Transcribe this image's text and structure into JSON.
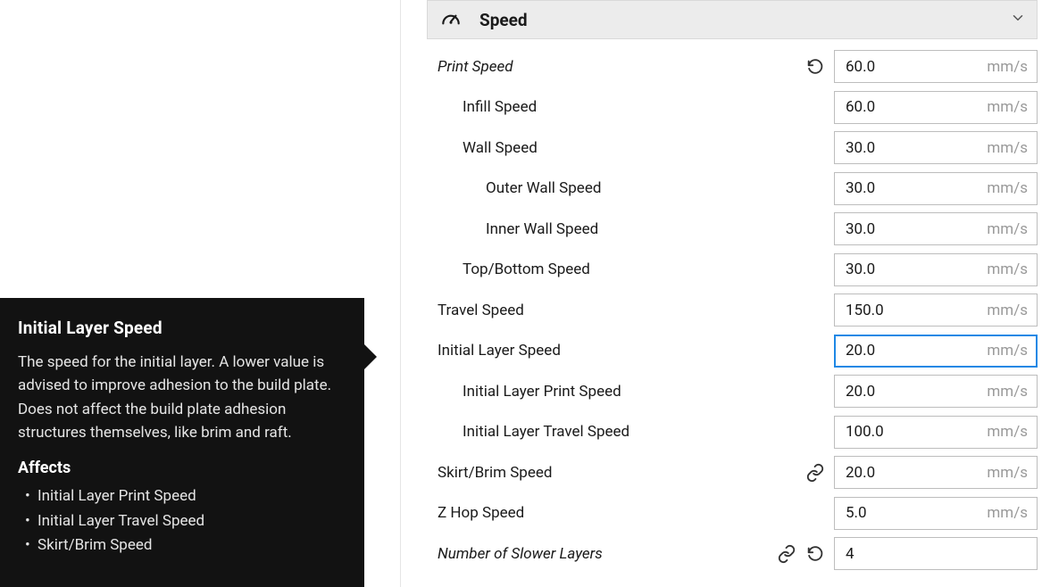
{
  "section": {
    "title": "Speed"
  },
  "tooltip": {
    "title": "Initial Layer Speed",
    "description": "The speed for the initial layer. A lower value is advised to improve adhesion to the build plate. Does not affect the build plate adhesion structures themselves, like brim and raft.",
    "affects_heading": "Affects",
    "affects": {
      "i0": "Initial Layer Print Speed",
      "i1": "Initial Layer Travel Speed",
      "i2": "Skirt/Brim Speed"
    }
  },
  "unit": "mm/s",
  "rows": {
    "print_speed": {
      "label": "Print Speed",
      "value": "60.0",
      "unit": "mm/s"
    },
    "infill_speed": {
      "label": "Infill Speed",
      "value": "60.0",
      "unit": "mm/s"
    },
    "wall_speed": {
      "label": "Wall Speed",
      "value": "30.0",
      "unit": "mm/s"
    },
    "outer_wall_speed": {
      "label": "Outer Wall Speed",
      "value": "30.0",
      "unit": "mm/s"
    },
    "inner_wall_speed": {
      "label": "Inner Wall Speed",
      "value": "30.0",
      "unit": "mm/s"
    },
    "top_bottom_speed": {
      "label": "Top/Bottom Speed",
      "value": "30.0",
      "unit": "mm/s"
    },
    "travel_speed": {
      "label": "Travel Speed",
      "value": "150.0",
      "unit": "mm/s"
    },
    "initial_layer_speed": {
      "label": "Initial Layer Speed",
      "value": "20.0",
      "unit": "mm/s"
    },
    "initial_print_speed": {
      "label": "Initial Layer Print Speed",
      "value": "20.0",
      "unit": "mm/s"
    },
    "initial_travel_speed": {
      "label": "Initial Layer Travel Speed",
      "value": "100.0",
      "unit": "mm/s"
    },
    "skirt_brim_speed": {
      "label": "Skirt/Brim Speed",
      "value": "20.0",
      "unit": "mm/s"
    },
    "z_hop_speed": {
      "label": "Z Hop Speed",
      "value": "5.0",
      "unit": "mm/s"
    },
    "slower_layers": {
      "label": "Number of Slower Layers",
      "value": "4",
      "unit": ""
    }
  }
}
